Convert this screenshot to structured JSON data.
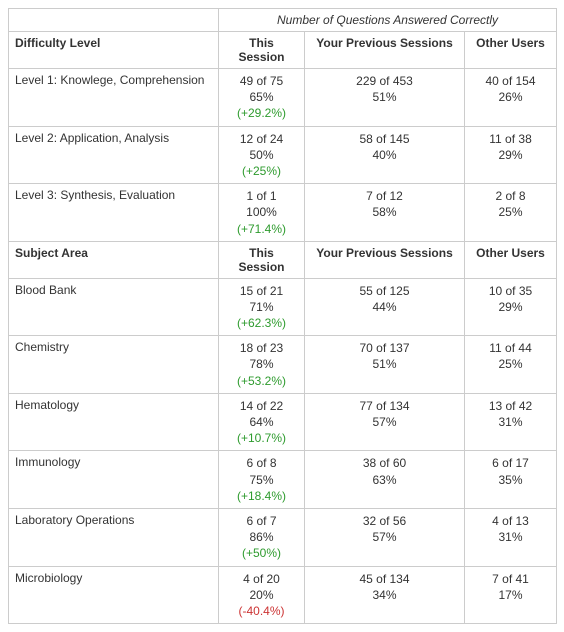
{
  "topHeader": "Number of Questions Answered Correctly",
  "columns": {
    "thisSession": "This Session",
    "previous": "Your Previous Sessions",
    "others": "Other Users"
  },
  "sections": [
    {
      "title": "Difficulty Level",
      "rows": [
        {
          "label": "Level 1: Knowlege, Comprehension",
          "thisSession": {
            "count": "49 of 75",
            "pct": "65%",
            "delta": "(+29.2%)",
            "deltaSign": "pos"
          },
          "previous": {
            "count": "229 of 453",
            "pct": "51%"
          },
          "others": {
            "count": "40 of 154",
            "pct": "26%"
          }
        },
        {
          "label": "Level 2: Application, Analysis",
          "thisSession": {
            "count": "12 of 24",
            "pct": "50%",
            "delta": "(+25%)",
            "deltaSign": "pos"
          },
          "previous": {
            "count": "58 of 145",
            "pct": "40%"
          },
          "others": {
            "count": "11 of 38",
            "pct": "29%"
          }
        },
        {
          "label": "Level 3: Synthesis, Evaluation",
          "thisSession": {
            "count": "1 of 1",
            "pct": "100%",
            "delta": "(+71.4%)",
            "deltaSign": "pos"
          },
          "previous": {
            "count": "7 of 12",
            "pct": "58%"
          },
          "others": {
            "count": "2 of 8",
            "pct": "25%"
          }
        }
      ]
    },
    {
      "title": "Subject Area",
      "rows": [
        {
          "label": "Blood Bank",
          "thisSession": {
            "count": "15 of 21",
            "pct": "71%",
            "delta": "(+62.3%)",
            "deltaSign": "pos"
          },
          "previous": {
            "count": "55 of 125",
            "pct": "44%"
          },
          "others": {
            "count": "10 of 35",
            "pct": "29%"
          }
        },
        {
          "label": "Chemistry",
          "thisSession": {
            "count": "18 of 23",
            "pct": "78%",
            "delta": "(+53.2%)",
            "deltaSign": "pos"
          },
          "previous": {
            "count": "70 of 137",
            "pct": "51%"
          },
          "others": {
            "count": "11 of 44",
            "pct": "25%"
          }
        },
        {
          "label": "Hematology",
          "thisSession": {
            "count": "14 of 22",
            "pct": "64%",
            "delta": "(+10.7%)",
            "deltaSign": "pos"
          },
          "previous": {
            "count": "77 of 134",
            "pct": "57%"
          },
          "others": {
            "count": "13 of 42",
            "pct": "31%"
          }
        },
        {
          "label": "Immunology",
          "thisSession": {
            "count": "6 of 8",
            "pct": "75%",
            "delta": "(+18.4%)",
            "deltaSign": "pos"
          },
          "previous": {
            "count": "38 of 60",
            "pct": "63%"
          },
          "others": {
            "count": "6 of 17",
            "pct": "35%"
          }
        },
        {
          "label": "Laboratory Operations",
          "thisSession": {
            "count": "6 of 7",
            "pct": "86%",
            "delta": "(+50%)",
            "deltaSign": "pos"
          },
          "previous": {
            "count": "32 of 56",
            "pct": "57%"
          },
          "others": {
            "count": "4 of 13",
            "pct": "31%"
          }
        },
        {
          "label": "Microbiology",
          "thisSession": {
            "count": "4 of 20",
            "pct": "20%",
            "delta": "(-40.4%)",
            "deltaSign": "neg"
          },
          "previous": {
            "count": "45 of 134",
            "pct": "34%"
          },
          "others": {
            "count": "7 of 41",
            "pct": "17%"
          }
        }
      ]
    }
  ],
  "chart_data": {
    "type": "table",
    "sections": [
      {
        "name": "Difficulty Level",
        "rows": [
          {
            "label": "Level 1: Knowlege, Comprehension",
            "this_correct": 49,
            "this_total": 75,
            "this_pct": 65,
            "delta_pct": 29.2,
            "prev_correct": 229,
            "prev_total": 453,
            "prev_pct": 51,
            "others_correct": 40,
            "others_total": 154,
            "others_pct": 26
          },
          {
            "label": "Level 2: Application, Analysis",
            "this_correct": 12,
            "this_total": 24,
            "this_pct": 50,
            "delta_pct": 25,
            "prev_correct": 58,
            "prev_total": 145,
            "prev_pct": 40,
            "others_correct": 11,
            "others_total": 38,
            "others_pct": 29
          },
          {
            "label": "Level 3: Synthesis, Evaluation",
            "this_correct": 1,
            "this_total": 1,
            "this_pct": 100,
            "delta_pct": 71.4,
            "prev_correct": 7,
            "prev_total": 12,
            "prev_pct": 58,
            "others_correct": 2,
            "others_total": 8,
            "others_pct": 25
          }
        ]
      },
      {
        "name": "Subject Area",
        "rows": [
          {
            "label": "Blood Bank",
            "this_correct": 15,
            "this_total": 21,
            "this_pct": 71,
            "delta_pct": 62.3,
            "prev_correct": 55,
            "prev_total": 125,
            "prev_pct": 44,
            "others_correct": 10,
            "others_total": 35,
            "others_pct": 29
          },
          {
            "label": "Chemistry",
            "this_correct": 18,
            "this_total": 23,
            "this_pct": 78,
            "delta_pct": 53.2,
            "prev_correct": 70,
            "prev_total": 137,
            "prev_pct": 51,
            "others_correct": 11,
            "others_total": 44,
            "others_pct": 25
          },
          {
            "label": "Hematology",
            "this_correct": 14,
            "this_total": 22,
            "this_pct": 64,
            "delta_pct": 10.7,
            "prev_correct": 77,
            "prev_total": 134,
            "prev_pct": 57,
            "others_correct": 13,
            "others_total": 42,
            "others_pct": 31
          },
          {
            "label": "Immunology",
            "this_correct": 6,
            "this_total": 8,
            "this_pct": 75,
            "delta_pct": 18.4,
            "prev_correct": 38,
            "prev_total": 60,
            "prev_pct": 63,
            "others_correct": 6,
            "others_total": 17,
            "others_pct": 35
          },
          {
            "label": "Laboratory Operations",
            "this_correct": 6,
            "this_total": 7,
            "this_pct": 86,
            "delta_pct": 50,
            "prev_correct": 32,
            "prev_total": 56,
            "prev_pct": 57,
            "others_correct": 4,
            "others_total": 13,
            "others_pct": 31
          },
          {
            "label": "Microbiology",
            "this_correct": 4,
            "this_total": 20,
            "this_pct": 20,
            "delta_pct": -40.4,
            "prev_correct": 45,
            "prev_total": 134,
            "prev_pct": 34,
            "others_correct": 7,
            "others_total": 41,
            "others_pct": 17
          }
        ]
      }
    ]
  }
}
